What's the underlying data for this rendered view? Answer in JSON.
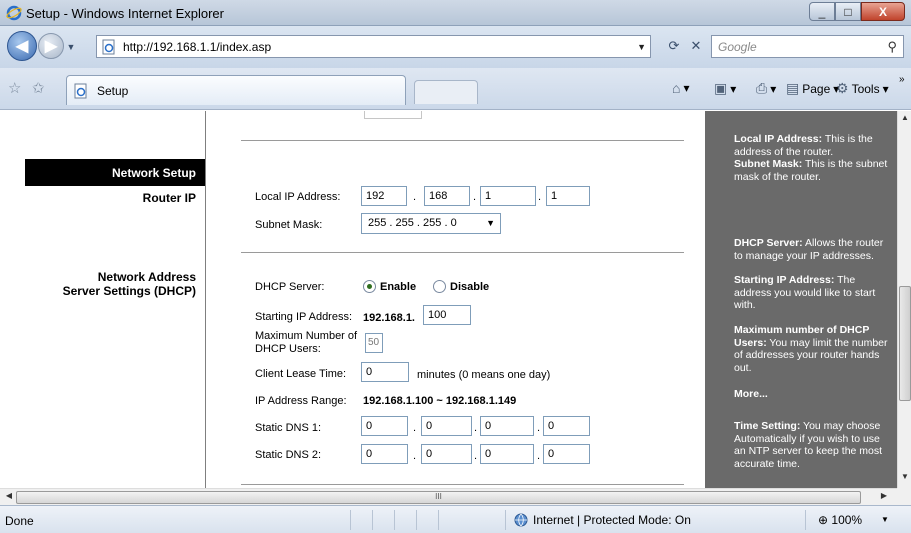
{
  "window": {
    "title": "Setup - Windows Internet Explorer",
    "minimize": "_",
    "maximize": "□",
    "close": "X"
  },
  "navbar": {
    "back": "◀",
    "forward": "▶",
    "url": "http://192.168.1.1/index.asp",
    "refresh": "⟳",
    "stop": "✕",
    "search_placeholder": "Google",
    "search_icon": "⚲"
  },
  "tabs": {
    "active_tab": "Setup"
  },
  "commandbar": {
    "page_label": "Page",
    "tools_label": "Tools"
  },
  "sidebar": {
    "section_header": "Network Setup",
    "router_ip": "Router IP",
    "dhcp_line1": "Network Address",
    "dhcp_line2": "Server Settings (DHCP)"
  },
  "form": {
    "local_ip_label": "Local IP Address:",
    "local_ip": [
      "192",
      "168",
      "1",
      "1"
    ],
    "subnet_label": "Subnet Mask:",
    "subnet_value": "255 . 255 . 255 . 0",
    "dhcp_label": "DHCP Server:",
    "dhcp_enable": "Enable",
    "dhcp_disable": "Disable",
    "dhcp_selected": "Enable",
    "start_ip_label": "Starting IP Address:",
    "start_ip_prefix": "192.168.1.",
    "start_ip_value": "100",
    "max_users_label_1": "Maximum Number of",
    "max_users_label_2": "DHCP Users:",
    "max_users_value": "50",
    "lease_label": "Client Lease Time:",
    "lease_value": "0",
    "lease_note": "minutes (0 means one day)",
    "range_label": "IP Address Range:",
    "range_value": "192.168.1.100 ~ 192.168.1.149",
    "dns1_label": "Static DNS 1:",
    "dns1": [
      "0",
      "0",
      "0",
      "0"
    ],
    "dns2_label": "Static DNS 2:",
    "dns2": [
      "0",
      "0",
      "0",
      "0"
    ],
    "octet_sep": "."
  },
  "help": {
    "local_ip_title": "Local IP Address:",
    "local_ip_text": " This is the address of the router.",
    "subnet_title": "Subnet Mask:",
    "subnet_text": " This is the subnet mask of the router.",
    "dhcp_title": "DHCP Server:",
    "dhcp_text": " Allows the router to manage your IP addresses.",
    "start_title": "Starting IP Address:",
    "start_text": " The address you would like to start with.",
    "max_title": "Maximum number of DHCP Users:",
    "max_text": " You may limit the number of addresses your router hands out.",
    "more": "More...",
    "time_title": "Time Setting:",
    "time_text": " You may choose Automatically if you wish to use an NTP server to keep the most accurate time."
  },
  "scroll": {
    "hthumb_grip": "III"
  },
  "statusbar": {
    "status": "Done",
    "zone": "Internet | Protected Mode: On",
    "zoom": "100%"
  },
  "colors": {
    "help_bg": "#6a6a6a",
    "header_bg": "#000000",
    "chrome": "#cbd8e9"
  }
}
